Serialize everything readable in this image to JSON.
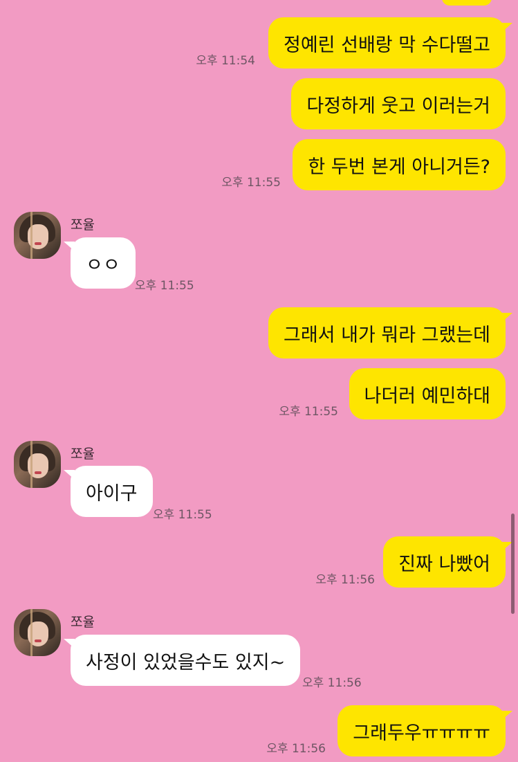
{
  "colors": {
    "background": "#f29bc3",
    "my_bubble": "#fee500",
    "other_bubble": "#ffffff",
    "time_text": "#6d5563"
  },
  "contact": {
    "name": "쪼율",
    "avatar": "avatar-photo"
  },
  "messages": [
    {
      "from": "me",
      "text": "정예린 선배랑 막 수다떨고",
      "time": "오후 11:54"
    },
    {
      "from": "me",
      "text": "다정하게 웃고 이러는거",
      "time": ""
    },
    {
      "from": "me",
      "text": "한 두번 본게 아니거든?",
      "time": "오후 11:55"
    },
    {
      "from": "other",
      "sender": "쪼율",
      "text": "ㅇㅇ",
      "time": "오후 11:55"
    },
    {
      "from": "me",
      "text": "그래서 내가 뭐라 그랬는데",
      "time": ""
    },
    {
      "from": "me",
      "text": "나더러 예민하대",
      "time": "오후 11:55"
    },
    {
      "from": "other",
      "sender": "쪼율",
      "text": "아이구",
      "time": "오후 11:55"
    },
    {
      "from": "me",
      "text": "진짜 나빴어",
      "time": "오후 11:56"
    },
    {
      "from": "other",
      "sender": "쪼율",
      "text": "사정이 있었을수도 있지~",
      "time": "오후 11:56"
    },
    {
      "from": "me",
      "text": "그래두우ㅠㅠㅠㅠ",
      "time": "오후 11:56"
    }
  ]
}
